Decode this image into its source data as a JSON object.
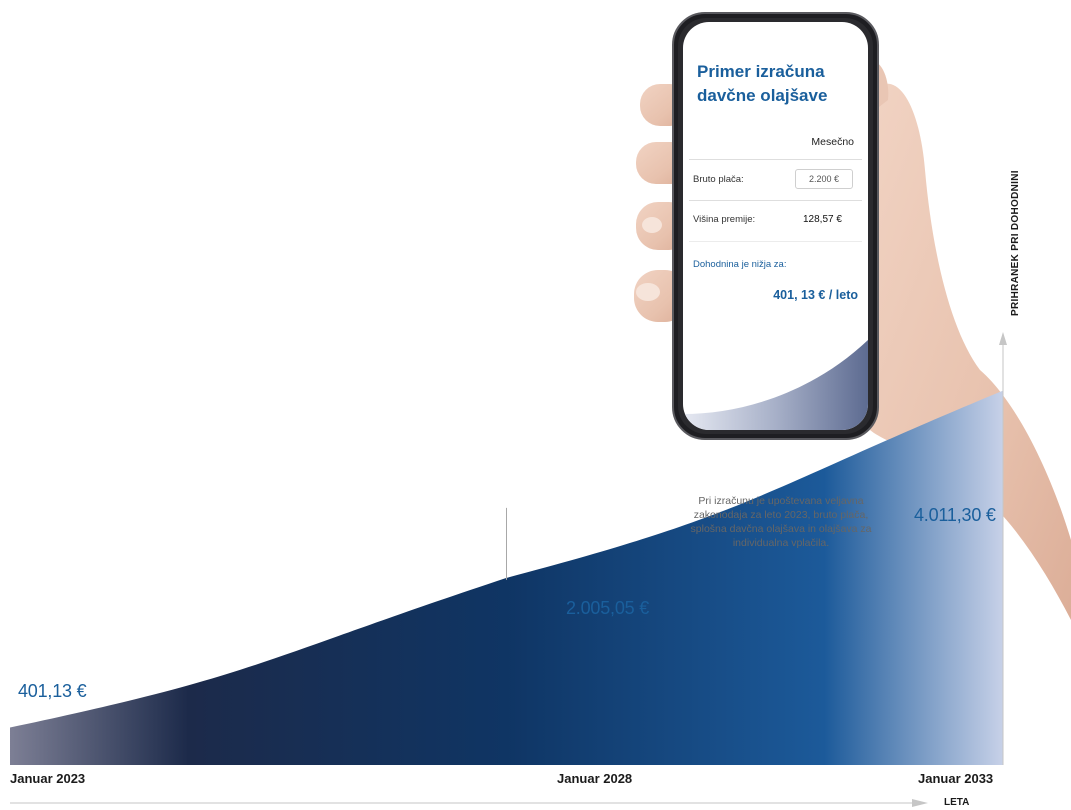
{
  "chart_data": {
    "type": "area",
    "x": [
      "Januar 2023",
      "Januar 2028",
      "Januar 2033"
    ],
    "values": [
      401.13,
      2005.05,
      4011.3
    ],
    "value_labels": [
      "401,13 €",
      "2.005,05 €",
      "4.011,30 €"
    ],
    "xlabel": "LETA",
    "ylabel": "PRIHRANEK PRI DOHODNINI",
    "ylim": [
      0,
      4500
    ],
    "grid": false,
    "colors": {
      "area_dark": "#0e3b73",
      "area_light": "#c7d1e8",
      "area_left": "#7d7f95",
      "value_text": "#1a5f9c"
    }
  },
  "note": "Pri izračunu je upoštevana veljavna zakonodaja za leto 2023, bruto plača, splošna davčna olajšava in olajšava za individualna vplačila.",
  "calculator": {
    "title": "Primer izračuna davčne olajšave",
    "column_header": "Mesečno",
    "gross_label": "Bruto plača:",
    "gross_value": "2.200 €",
    "premium_label": "Višina premije:",
    "premium_value": "128,57 €",
    "result_label": "Dohodnina je nižja za:",
    "result_value": "401, 13 € / leto"
  }
}
